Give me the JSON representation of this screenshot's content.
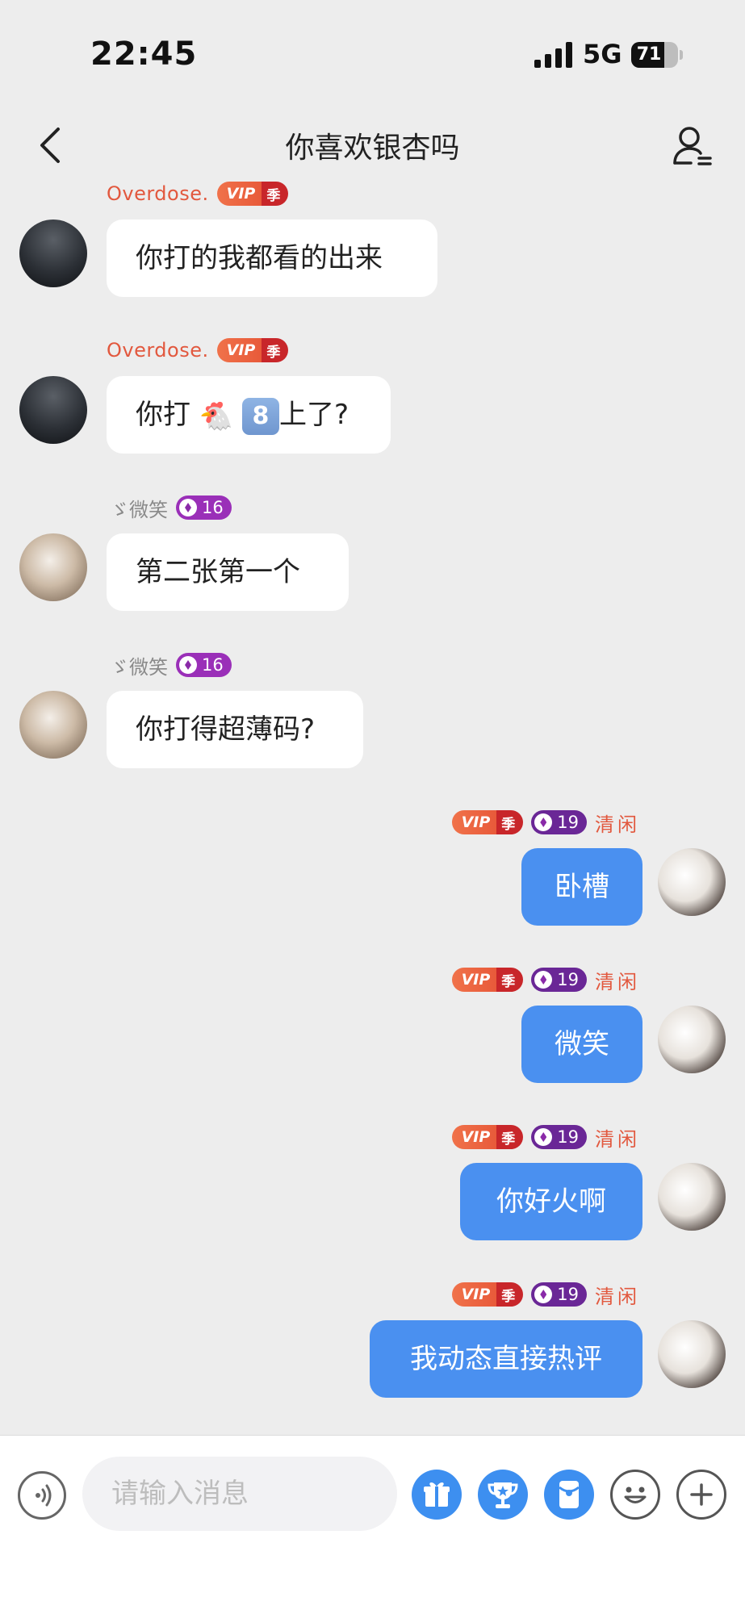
{
  "status_bar": {
    "time": "22:45",
    "network": "5G",
    "battery": "71",
    "battery_level": 0.71
  },
  "header": {
    "title": "你喜欢银杏吗"
  },
  "messages": [
    {
      "side": "left",
      "sender": "Overdose.",
      "vip": "VIP",
      "season": "季",
      "text": "你打的我都看的出来"
    },
    {
      "side": "left",
      "sender": "Overdose.",
      "vip": "VIP",
      "season": "季",
      "text_parts": [
        "你打",
        "🐔",
        "8",
        "上了?"
      ]
    },
    {
      "side": "left",
      "sender": "ゞ微笑",
      "level": "16",
      "text": "第二张第一个"
    },
    {
      "side": "left",
      "sender": "ゞ微笑",
      "level": "16",
      "text": "你打得超薄码?"
    },
    {
      "side": "right",
      "sender": "清闲",
      "vip": "VIP",
      "season": "季",
      "level": "19",
      "text": "卧槽"
    },
    {
      "side": "right",
      "sender": "清闲",
      "vip": "VIP",
      "season": "季",
      "level": "19",
      "text": "微笑"
    },
    {
      "side": "right",
      "sender": "清闲",
      "vip": "VIP",
      "season": "季",
      "level": "19",
      "text": "你好火啊"
    },
    {
      "side": "right",
      "sender": "清闲",
      "vip": "VIP",
      "season": "季",
      "level": "19",
      "text": "我动态直接热评"
    }
  ],
  "input_bar": {
    "placeholder": "请输入消息",
    "icons": [
      "voice-icon",
      "gift-icon",
      "trophy-icon",
      "red-packet-icon",
      "emoji-icon",
      "plus-icon"
    ]
  },
  "colors": {
    "background": "#ededed",
    "out_bubble": "#4a90f0",
    "in_bubble": "#ffffff",
    "name_accent": "#e2583e",
    "level_badge": "#9a2fb8",
    "action_blue": "#3d8ff0"
  }
}
